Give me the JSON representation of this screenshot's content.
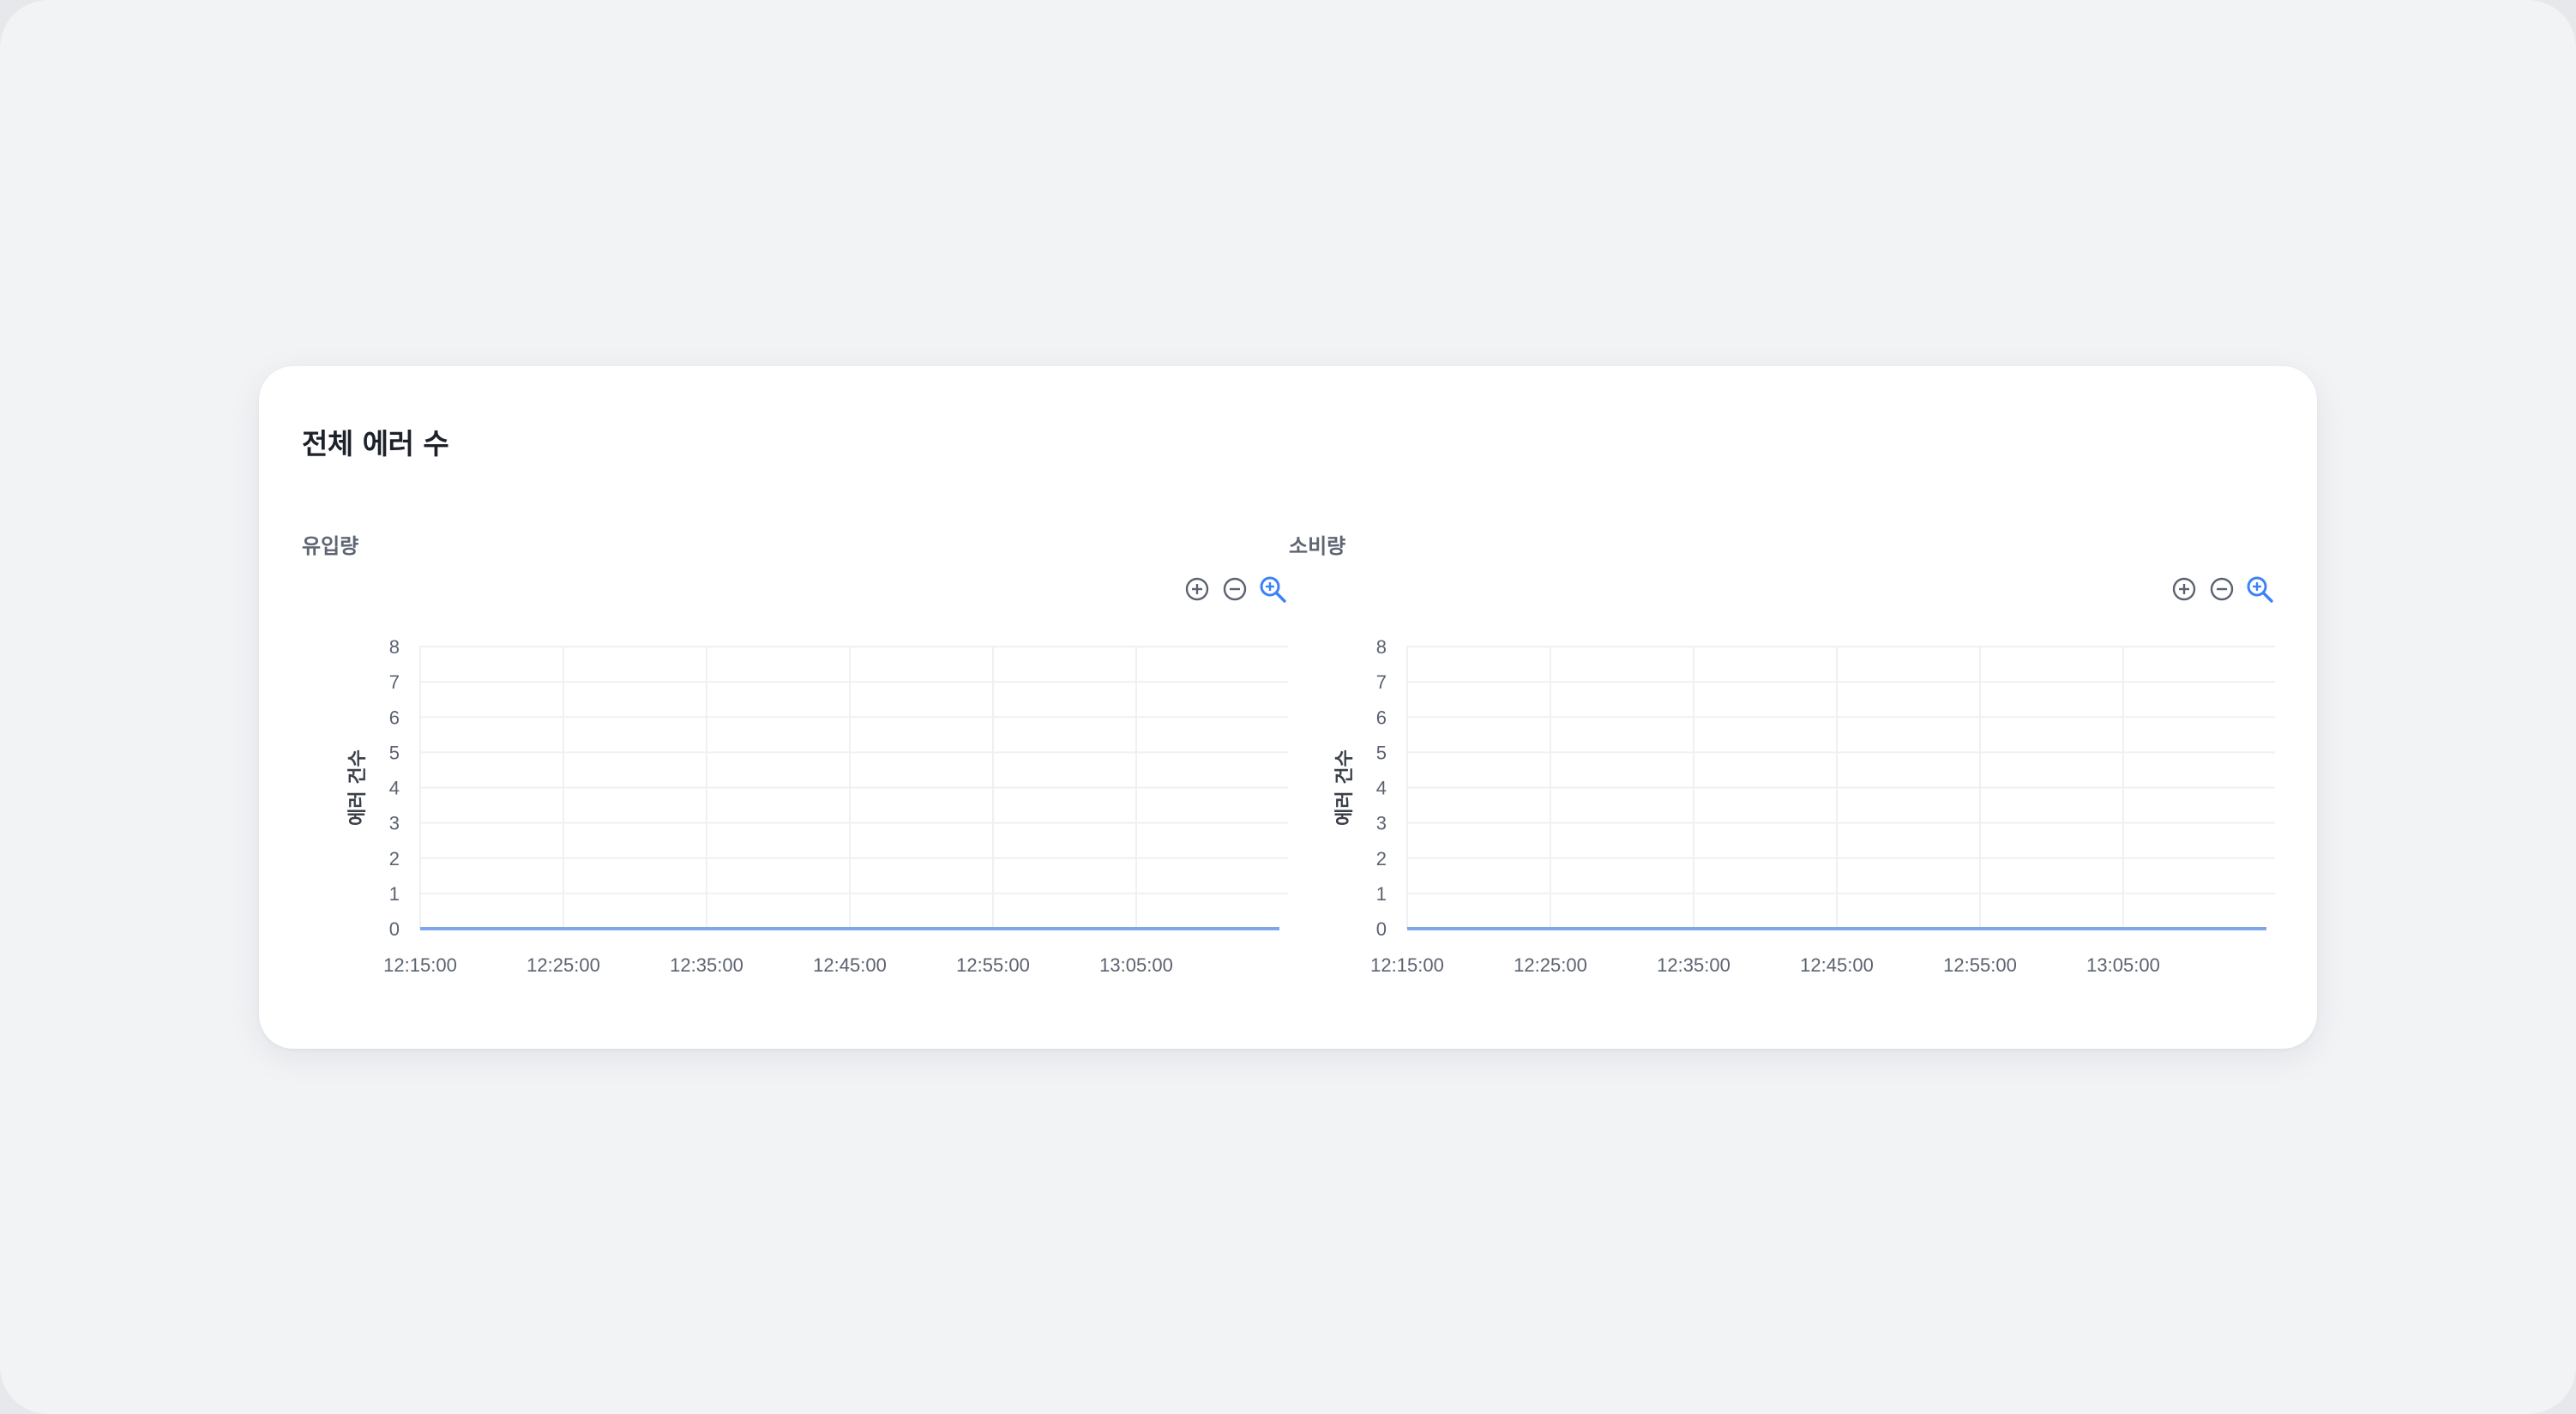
{
  "card": {
    "title": "전체 에러 수"
  },
  "toolbox": {
    "zoom_in_icon": "plus-circle-icon",
    "zoom_out_icon": "minus-circle-icon",
    "zoom_reset_icon": "magnify-icon"
  },
  "colors": {
    "series_line": "#7ea6ec",
    "grid": "#eef0f3",
    "axis": "#d0d4da",
    "tool_icon": "#5b6270",
    "tool_active": "#3b82f6"
  },
  "chart_data": [
    {
      "type": "line",
      "title": "유입량",
      "xlabel": "",
      "ylabel": "에러 건수",
      "x_ticks": [
        "12:15:00",
        "12:25:00",
        "12:35:00",
        "12:45:00",
        "12:55:00",
        "13:05:00"
      ],
      "ylim": [
        0,
        8
      ],
      "y_ticks": [
        "0",
        "1",
        "2",
        "3",
        "4",
        "5",
        "6",
        "7",
        "8"
      ],
      "grid": true,
      "series": [
        {
          "x": [
            "12:15:00",
            "12:25:00",
            "12:35:00",
            "12:45:00",
            "12:55:00",
            "13:05:00",
            "13:15:00"
          ],
          "values": [
            0,
            0,
            0,
            0,
            0,
            0,
            0
          ]
        }
      ]
    },
    {
      "type": "line",
      "title": "소비량",
      "xlabel": "",
      "ylabel": "에러 건수",
      "x_ticks": [
        "12:15:00",
        "12:25:00",
        "12:35:00",
        "12:45:00",
        "12:55:00",
        "13:05:00"
      ],
      "ylim": [
        0,
        8
      ],
      "y_ticks": [
        "0",
        "1",
        "2",
        "3",
        "4",
        "5",
        "6",
        "7",
        "8"
      ],
      "grid": true,
      "series": [
        {
          "x": [
            "12:15:00",
            "12:25:00",
            "12:35:00",
            "12:45:00",
            "12:55:00",
            "13:05:00",
            "13:15:00"
          ],
          "values": [
            0,
            0,
            0,
            0,
            0,
            0,
            0
          ]
        }
      ]
    }
  ]
}
